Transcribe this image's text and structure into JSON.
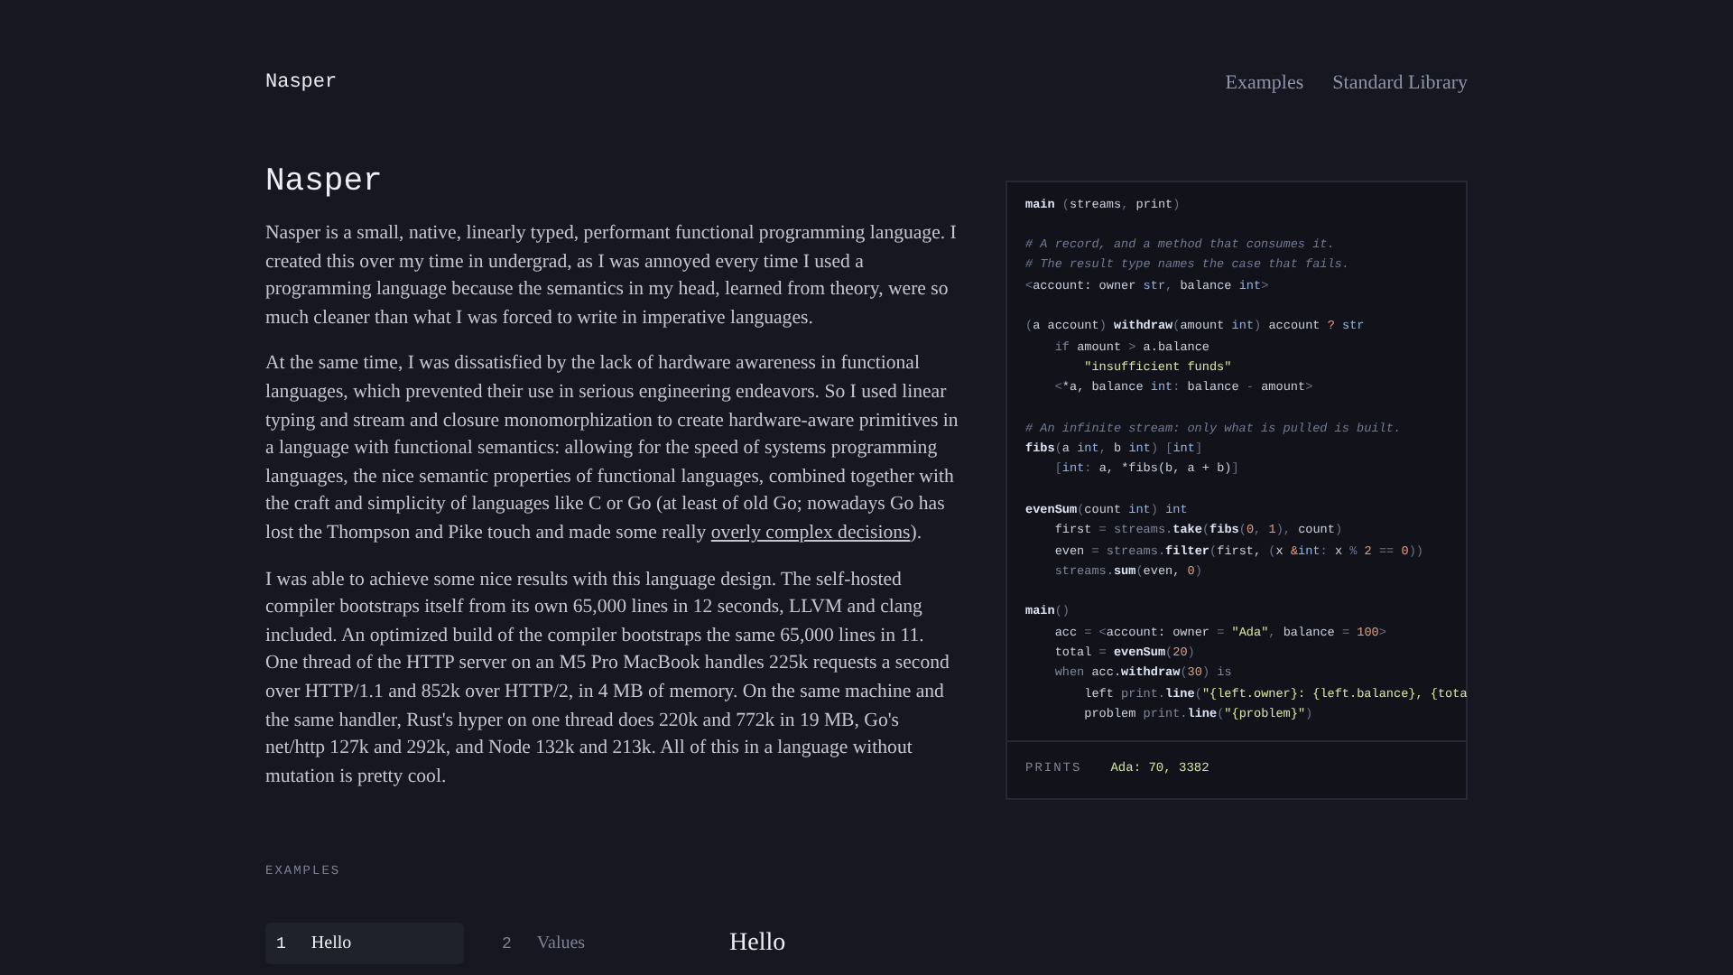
{
  "nav": {
    "brand": "Nasper",
    "links": [
      "Examples",
      "Standard Library"
    ]
  },
  "intro": {
    "title": "Nasper",
    "paragraphs": [
      {
        "text": "Nasper is a small, native, linearly typed, performant functional programming language. I created this over my time in undergrad, as I was annoyed every time I used a programming language because the semantics in my head, learned from theory, were so much cleaner than what I was forced to write in imperative languages."
      },
      {
        "text": "At the same time, I was dissatisfied by the lack of hardware awareness in functional languages, which prevented their use in serious engineering endeavors. So I used linear typing and stream and closure monomorphization to create hardware-aware primitives in a language with functional semantics: allowing for the speed of systems programming languages, the nice semantic properties of functional languages, combined together with the craft and simplicity of languages like C or Go (at least of old Go; nowadays Go has lost the Thompson and Pike touch and made some really ",
        "link": "overly complex decisions",
        "after": ")."
      },
      {
        "text": "I was able to achieve some nice results with this language design. The self-hosted compiler bootstraps itself from its own 65,000 lines in 12 seconds, LLVM and clang included. An optimized build of the compiler bootstraps the same 65,000 lines in 11. One thread of the HTTP server on an M5 Pro MacBook handles 225k requests a second over HTTP/1.1 and 852k over HTTP/2, in 4 MB of memory. On the same machine and the same handler, Rust's hyper on one thread does 220k and 772k in 19 MB, Go's net/http 127k and 292k, and Node 132k and 213k. All of this in a language without mutation is pretty cool."
      }
    ]
  },
  "code": {
    "lines": [
      {
        "kind": "code",
        "tokens": [
          {
            "kind": "fn",
            "text": "main"
          },
          {
            "kind": "punct",
            "text": " ("
          },
          {
            "kind": "plain",
            "text": "streams"
          },
          {
            "kind": "punct",
            "text": ", "
          },
          {
            "kind": "plain",
            "text": "print"
          },
          {
            "kind": "punct",
            "text": ")"
          }
        ]
      },
      {
        "kind": "blank"
      },
      {
        "kind": "code",
        "tokens": [
          {
            "kind": "comment",
            "text": "# A record, and a method that consumes it."
          }
        ]
      },
      {
        "kind": "code",
        "tokens": [
          {
            "kind": "comment",
            "text": "# The result type names the case that fails."
          }
        ]
      },
      {
        "kind": "code",
        "tokens": [
          {
            "kind": "punct",
            "text": "<"
          },
          {
            "kind": "plain",
            "text": "account: owner "
          },
          {
            "kind": "type",
            "text": "str"
          },
          {
            "kind": "punct",
            "text": ", "
          },
          {
            "kind": "plain",
            "text": "balance "
          },
          {
            "kind": "type",
            "text": "int"
          },
          {
            "kind": "punct",
            "text": ">"
          }
        ]
      },
      {
        "kind": "blank"
      },
      {
        "kind": "code",
        "tokens": [
          {
            "kind": "punct",
            "text": "("
          },
          {
            "kind": "plain",
            "text": "a account"
          },
          {
            "kind": "punct",
            "text": ") "
          },
          {
            "kind": "fn",
            "text": "withdraw"
          },
          {
            "kind": "punct",
            "text": "("
          },
          {
            "kind": "plain",
            "text": "amount "
          },
          {
            "kind": "type",
            "text": "int"
          },
          {
            "kind": "punct",
            "text": ") "
          },
          {
            "kind": "plain",
            "text": "account "
          },
          {
            "kind": "num",
            "text": "?"
          },
          {
            "kind": "type",
            "text": " str"
          }
        ]
      },
      {
        "kind": "code",
        "tokens": [
          {
            "kind": "kw",
            "text": "    if "
          },
          {
            "kind": "plain",
            "text": "amount "
          },
          {
            "kind": "punct",
            "text": "> "
          },
          {
            "kind": "plain",
            "text": "a.balance"
          }
        ]
      },
      {
        "kind": "code",
        "tokens": [
          {
            "kind": "str",
            "text": "        \"insufficient funds\""
          }
        ]
      },
      {
        "kind": "code",
        "tokens": [
          {
            "kind": "punct",
            "text": "    <"
          },
          {
            "kind": "plain",
            "text": "*a, balance "
          },
          {
            "kind": "type",
            "text": "int"
          },
          {
            "kind": "punct",
            "text": ": "
          },
          {
            "kind": "plain",
            "text": "balance "
          },
          {
            "kind": "punct",
            "text": "- "
          },
          {
            "kind": "plain",
            "text": "amount"
          },
          {
            "kind": "punct",
            "text": ">"
          }
        ]
      },
      {
        "kind": "blank"
      },
      {
        "kind": "code",
        "tokens": [
          {
            "kind": "comment",
            "text": "# An infinite stream: only what is pulled is built."
          }
        ]
      },
      {
        "kind": "code",
        "tokens": [
          {
            "kind": "fn",
            "text": "fibs"
          },
          {
            "kind": "punct",
            "text": "("
          },
          {
            "kind": "plain",
            "text": "a "
          },
          {
            "kind": "type",
            "text": "int"
          },
          {
            "kind": "punct",
            "text": ", "
          },
          {
            "kind": "plain",
            "text": "b "
          },
          {
            "kind": "type",
            "text": "int"
          },
          {
            "kind": "punct",
            "text": ") ["
          },
          {
            "kind": "type",
            "text": "int"
          },
          {
            "kind": "punct",
            "text": "]"
          }
        ]
      },
      {
        "kind": "code",
        "tokens": [
          {
            "kind": "punct",
            "text": "    ["
          },
          {
            "kind": "type",
            "text": "int"
          },
          {
            "kind": "punct",
            "text": ": "
          },
          {
            "kind": "plain",
            "text": "a, *fibs(b, a + b)"
          },
          {
            "kind": "punct",
            "text": "]"
          }
        ]
      },
      {
        "kind": "blank"
      },
      {
        "kind": "code",
        "tokens": [
          {
            "kind": "fn",
            "text": "evenSum"
          },
          {
            "kind": "punct",
            "text": "("
          },
          {
            "kind": "plain",
            "text": "count "
          },
          {
            "kind": "type",
            "text": "int"
          },
          {
            "kind": "punct",
            "text": ") "
          },
          {
            "kind": "type",
            "text": "int"
          }
        ]
      },
      {
        "kind": "code",
        "tokens": [
          {
            "kind": "plain",
            "text": "    first "
          },
          {
            "kind": "punct",
            "text": "= "
          },
          {
            "kind": "kw",
            "text": "streams."
          },
          {
            "kind": "fn",
            "text": "take"
          },
          {
            "kind": "punct",
            "text": "("
          },
          {
            "kind": "fn",
            "text": "fibs"
          },
          {
            "kind": "punct",
            "text": "("
          },
          {
            "kind": "num",
            "text": "0"
          },
          {
            "kind": "punct",
            "text": ", "
          },
          {
            "kind": "num",
            "text": "1"
          },
          {
            "kind": "punct",
            "text": "), "
          },
          {
            "kind": "plain",
            "text": "count"
          },
          {
            "kind": "punct",
            "text": ")"
          }
        ]
      },
      {
        "kind": "code",
        "tokens": [
          {
            "kind": "plain",
            "text": "    even "
          },
          {
            "kind": "punct",
            "text": "= "
          },
          {
            "kind": "kw",
            "text": "streams."
          },
          {
            "kind": "fn",
            "text": "filter"
          },
          {
            "kind": "punct",
            "text": "("
          },
          {
            "kind": "plain",
            "text": "first, "
          },
          {
            "kind": "punct",
            "text": "("
          },
          {
            "kind": "plain",
            "text": "x "
          },
          {
            "kind": "num",
            "text": "&"
          },
          {
            "kind": "type",
            "text": "int"
          },
          {
            "kind": "punct",
            "text": ": "
          },
          {
            "kind": "plain",
            "text": "x "
          },
          {
            "kind": "punct",
            "text": "% "
          },
          {
            "kind": "num",
            "text": "2"
          },
          {
            "kind": "punct",
            "text": " == "
          },
          {
            "kind": "num",
            "text": "0"
          },
          {
            "kind": "punct",
            "text": "))"
          }
        ]
      },
      {
        "kind": "code",
        "tokens": [
          {
            "kind": "kw",
            "text": "    streams."
          },
          {
            "kind": "fn",
            "text": "sum"
          },
          {
            "kind": "punct",
            "text": "("
          },
          {
            "kind": "plain",
            "text": "even, "
          },
          {
            "kind": "num",
            "text": "0"
          },
          {
            "kind": "punct",
            "text": ")"
          }
        ]
      },
      {
        "kind": "blank"
      },
      {
        "kind": "code",
        "tokens": [
          {
            "kind": "fn",
            "text": "main"
          },
          {
            "kind": "punct",
            "text": "()"
          }
        ]
      },
      {
        "kind": "code",
        "tokens": [
          {
            "kind": "plain",
            "text": "    acc "
          },
          {
            "kind": "punct",
            "text": "= <"
          },
          {
            "kind": "plain",
            "text": "account: owner "
          },
          {
            "kind": "punct",
            "text": "= "
          },
          {
            "kind": "str",
            "text": "\"Ada\""
          },
          {
            "kind": "punct",
            "text": ", "
          },
          {
            "kind": "plain",
            "text": "balance "
          },
          {
            "kind": "punct",
            "text": "= "
          },
          {
            "kind": "num",
            "text": "100"
          },
          {
            "kind": "punct",
            "text": ">"
          }
        ]
      },
      {
        "kind": "code",
        "tokens": [
          {
            "kind": "plain",
            "text": "    total "
          },
          {
            "kind": "punct",
            "text": "= "
          },
          {
            "kind": "fn",
            "text": "evenSum"
          },
          {
            "kind": "punct",
            "text": "("
          },
          {
            "kind": "num",
            "text": "20"
          },
          {
            "kind": "punct",
            "text": ")"
          }
        ]
      },
      {
        "kind": "code",
        "tokens": [
          {
            "kind": "kw",
            "text": "    when "
          },
          {
            "kind": "plain",
            "text": "acc."
          },
          {
            "kind": "fn",
            "text": "withdraw"
          },
          {
            "kind": "punct",
            "text": "("
          },
          {
            "kind": "num",
            "text": "30"
          },
          {
            "kind": "punct",
            "text": ") "
          },
          {
            "kind": "kw",
            "text": "is"
          }
        ]
      },
      {
        "kind": "code",
        "tokens": [
          {
            "kind": "plain",
            "text": "        left "
          },
          {
            "kind": "kw",
            "text": "print."
          },
          {
            "kind": "fn",
            "text": "line"
          },
          {
            "kind": "punct",
            "text": "("
          },
          {
            "kind": "str",
            "text": "\"{left.owner}: {left.balance}, {tota"
          }
        ]
      },
      {
        "kind": "code",
        "tokens": [
          {
            "kind": "plain",
            "text": "        problem "
          },
          {
            "kind": "kw",
            "text": "print."
          },
          {
            "kind": "fn",
            "text": "line"
          },
          {
            "kind": "punct",
            "text": "("
          },
          {
            "kind": "str",
            "text": "\"{problem}\""
          },
          {
            "kind": "punct",
            "text": ")"
          }
        ]
      }
    ],
    "output_label": "PRINTS",
    "output": "Ada: 70, 3382"
  },
  "examples": {
    "label": "EXAMPLES",
    "tabs": [
      {
        "number": "1",
        "label": "Hello",
        "selected": true
      },
      {
        "number": "2",
        "label": "Values",
        "selected": false
      }
    ],
    "heading": "Hello"
  }
}
